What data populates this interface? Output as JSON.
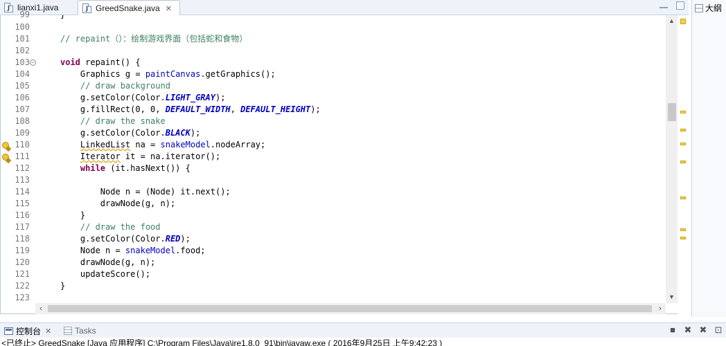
{
  "tabs": [
    {
      "label": "lianxi1.java",
      "active": false
    },
    {
      "label": "GreedSnake.java",
      "active": true,
      "close": "✕"
    }
  ],
  "outline_panel": {
    "label": "大纲"
  },
  "editor": {
    "lines": [
      {
        "num": "99",
        "fold": false,
        "warning": false,
        "text": ""
      },
      {
        "num": "100",
        "fold": false,
        "warning": false,
        "text": ""
      },
      {
        "num": "101",
        "fold": false,
        "warning": false,
        "text": ""
      },
      {
        "num": "102",
        "fold": false,
        "warning": false,
        "text": ""
      },
      {
        "num": "103",
        "fold": true,
        "warning": false,
        "text": ""
      },
      {
        "num": "104",
        "fold": false,
        "warning": false,
        "text": ""
      },
      {
        "num": "105",
        "fold": false,
        "warning": false,
        "text": ""
      },
      {
        "num": "106",
        "fold": false,
        "warning": false,
        "text": ""
      },
      {
        "num": "107",
        "fold": false,
        "warning": false,
        "text": ""
      },
      {
        "num": "108",
        "fold": false,
        "warning": false,
        "text": ""
      },
      {
        "num": "109",
        "fold": false,
        "warning": false,
        "text": ""
      },
      {
        "num": "110",
        "fold": false,
        "warning": true,
        "text": ""
      },
      {
        "num": "111",
        "fold": false,
        "warning": true,
        "text": ""
      },
      {
        "num": "112",
        "fold": false,
        "warning": false,
        "text": ""
      },
      {
        "num": "113",
        "fold": false,
        "warning": false,
        "text": ""
      },
      {
        "num": "114",
        "fold": false,
        "warning": false,
        "text": ""
      },
      {
        "num": "115",
        "fold": false,
        "warning": false,
        "text": ""
      },
      {
        "num": "116",
        "fold": false,
        "warning": false,
        "text": ""
      },
      {
        "num": "117",
        "fold": false,
        "warning": false,
        "text": ""
      },
      {
        "num": "118",
        "fold": false,
        "warning": false,
        "text": ""
      },
      {
        "num": "119",
        "fold": false,
        "warning": false,
        "text": ""
      },
      {
        "num": "120",
        "fold": false,
        "warning": false,
        "text": ""
      },
      {
        "num": "121",
        "fold": false,
        "warning": false,
        "text": ""
      },
      {
        "num": "122",
        "fold": false,
        "warning": false,
        "text": ""
      },
      {
        "num": "123",
        "fold": false,
        "warning": false,
        "text": ""
      }
    ],
    "code": {
      "l99": "}",
      "l101": "// repaint（）：绘制游戏界面（包括蛇和食物）",
      "l103_kw": "void",
      "l103": " repaint() {",
      "l104_a": "    Graphics g = ",
      "l104_f": "paintCanvas",
      "l104_b": ".getGraphics();",
      "l105": "    // draw background",
      "l106_a": "    g.setColor(Color.",
      "l106_s": "LIGHT_GRAY",
      "l106_b": ");",
      "l107_a": "    g.fillRect(0, 0, ",
      "l107_s1": "DEFAULT_WIDTH",
      "l107_m": ", ",
      "l107_s2": "DEFAULT_HEIGHT",
      "l107_b": ");",
      "l108": "    // draw the snake",
      "l109_a": "    g.setColor(Color.",
      "l109_s": "BLACK",
      "l109_b": ");",
      "l110_ind": "    ",
      "l110_w": "LinkedList",
      "l110_a": " na = ",
      "l110_f": "snakeModel",
      "l110_b": ".nodeArray;",
      "l111_ind": "    ",
      "l111_w": "Iterator",
      "l111_a": " it = na.iterator();",
      "l112_ind": "    ",
      "l112_kw": "while",
      "l112_a": " (it.hasNext()) {",
      "l114": "        Node n = (Node) it.next();",
      "l115": "        drawNode(g, n);",
      "l116": "    }",
      "l117": "    // draw the food",
      "l118_a": "    g.setColor(Color.",
      "l118_s": "RED",
      "l118_b": ");",
      "l119_a": "    Node n = ",
      "l119_f": "snakeModel",
      "l119_b": ".food;",
      "l120": "    drawNode(g, n);",
      "l121": "    updateScore();",
      "l122": "}"
    }
  },
  "console": {
    "tabs": [
      {
        "label": "控制台",
        "close": "✕"
      },
      {
        "label": "Tasks"
      }
    ],
    "status_text": "<已终止> GreedSnake [Java 应用程序] C:\\Program Files\\Java\\jre1.8.0_91\\bin\\javaw.exe ( 2016年9月25日 上午9:42:23 )"
  },
  "colors": {
    "keyword": "#7f0055",
    "comment": "#3f7f5f",
    "field": "#0000c0",
    "line_number": "#787878",
    "warning": "#f0c63a"
  },
  "icons": [
    "java-file-icon",
    "close-icon",
    "minimize-icon",
    "maximize-icon",
    "outline-icon",
    "console-icon",
    "tasks-icon",
    "warning-icon",
    "fold-icon",
    "terminate-icon",
    "remove-launch-icon"
  ]
}
